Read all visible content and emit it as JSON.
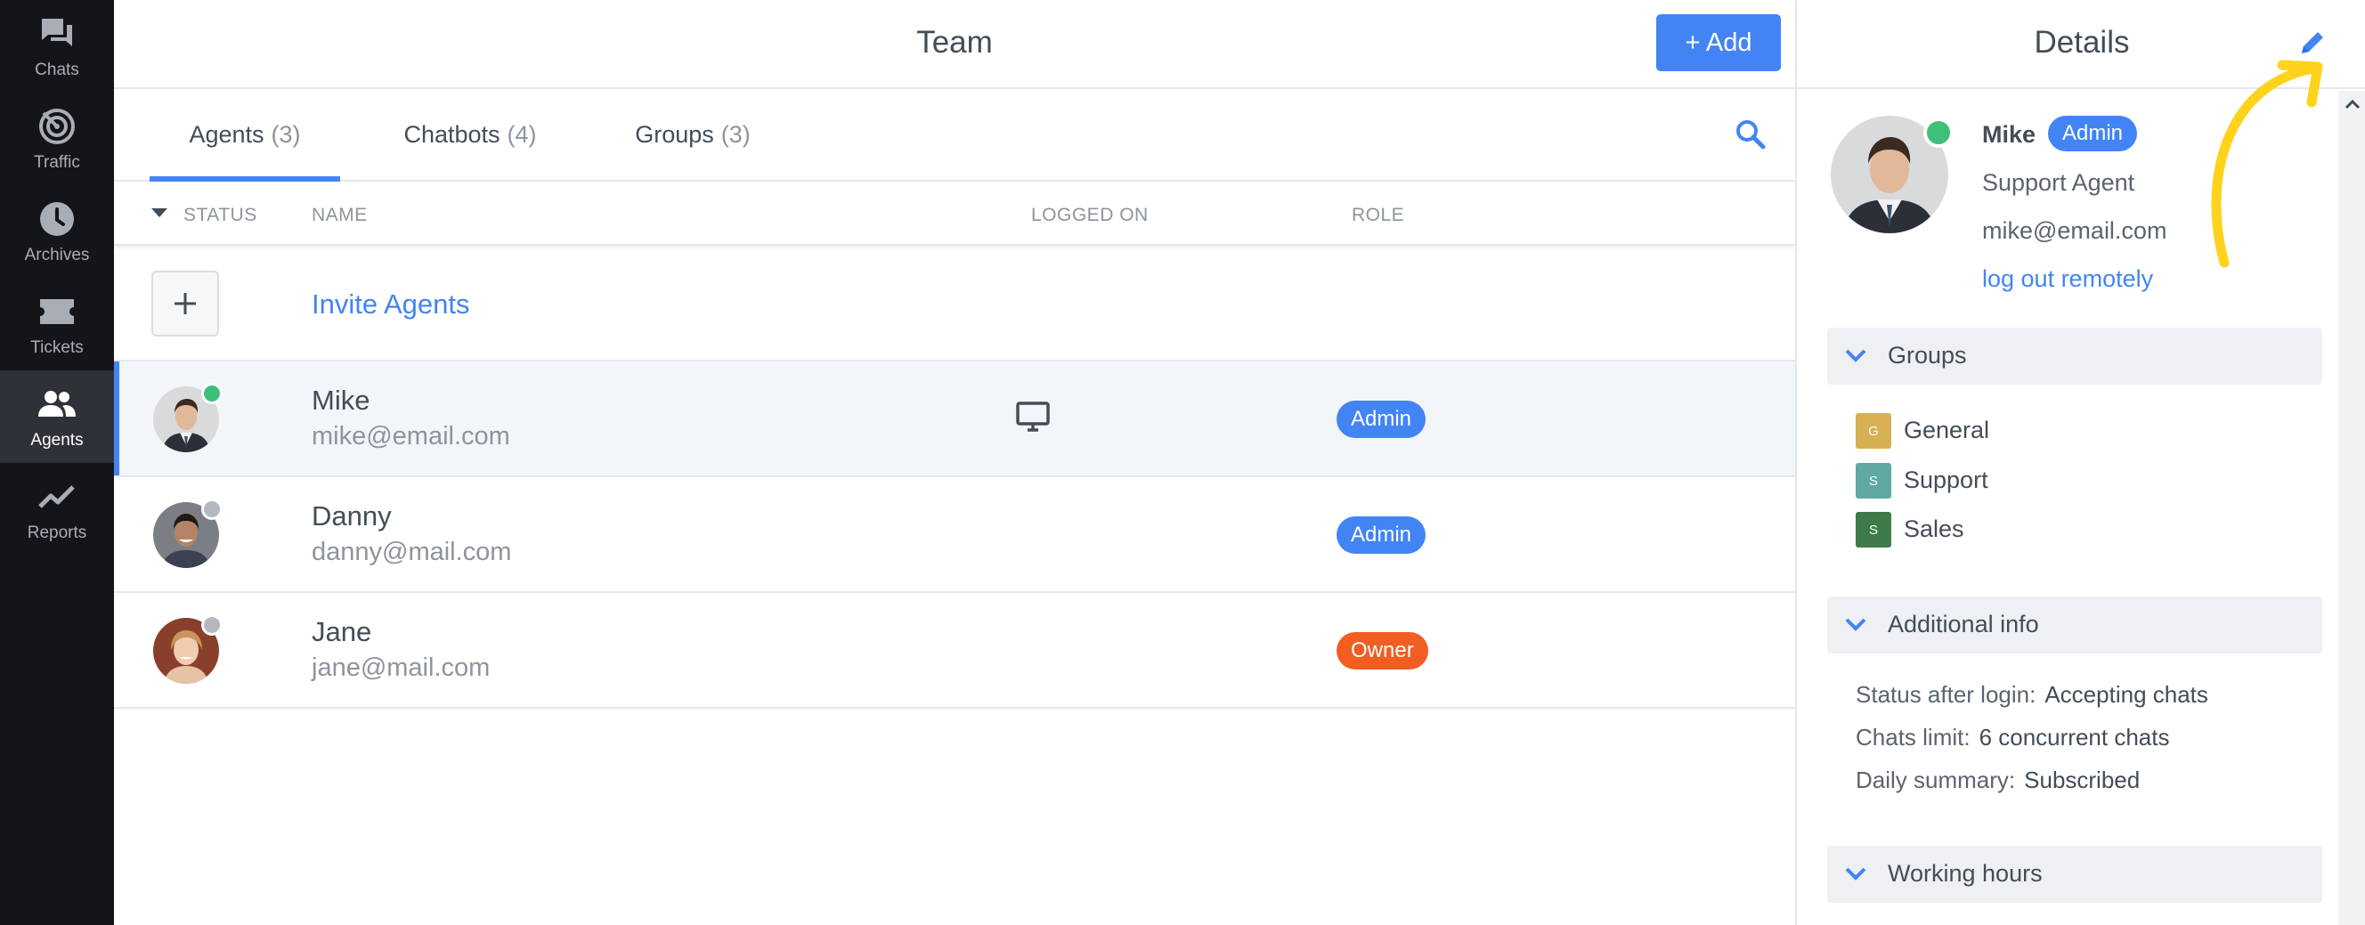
{
  "nav": {
    "items": [
      {
        "label": "Chats",
        "icon": "chats-icon"
      },
      {
        "label": "Traffic",
        "icon": "traffic-icon"
      },
      {
        "label": "Archives",
        "icon": "clock-icon"
      },
      {
        "label": "Tickets",
        "icon": "ticket-icon"
      },
      {
        "label": "Agents",
        "icon": "agents-icon",
        "active": true
      },
      {
        "label": "Reports",
        "icon": "reports-icon"
      }
    ]
  },
  "header": {
    "title": "Team",
    "add_label": "+ Add"
  },
  "tabs": [
    {
      "label": "Agents",
      "count": "(3)",
      "active": true
    },
    {
      "label": "Chatbots",
      "count": "(4)"
    },
    {
      "label": "Groups",
      "count": "(3)"
    }
  ],
  "table": {
    "columns": [
      "STATUS",
      "NAME",
      "LOGGED ON",
      "ROLE"
    ],
    "invite_label": "Invite Agents",
    "rows": [
      {
        "name": "Mike",
        "email": "mike@email.com",
        "role": "Admin",
        "status": "online",
        "logged_on": "desktop-icon"
      },
      {
        "name": "Danny",
        "email": "danny@mail.com",
        "role": "Admin",
        "status": "offline",
        "logged_on": ""
      },
      {
        "name": "Jane",
        "email": "jane@mail.com",
        "role": "Owner",
        "status": "offline",
        "logged_on": ""
      }
    ]
  },
  "details": {
    "title": "Details",
    "agent": {
      "name": "Mike",
      "badge": "Admin",
      "job_title": "Support Agent",
      "email": "mike@email.com",
      "logout_label": "log out remotely"
    },
    "groups_title": "Groups",
    "groups": [
      {
        "initial": "G",
        "name": "General",
        "color": "#d6b052"
      },
      {
        "initial": "S",
        "name": "Support",
        "color": "#5fa9a1"
      },
      {
        "initial": "S",
        "name": "Sales",
        "color": "#3f7a4a"
      }
    ],
    "additional_title": "Additional info",
    "info": [
      {
        "key": "Status after login:",
        "value": "Accepting chats"
      },
      {
        "key": "Chats limit:",
        "value": "6 concurrent chats"
      },
      {
        "key": "Daily summary:",
        "value": "Subscribed"
      }
    ],
    "working_hours_title": "Working hours"
  },
  "colors": {
    "accent": "#4384f5",
    "online": "#3ec07a",
    "offline": "#b4b9c0",
    "admin_badge": "#4384f5",
    "owner_badge": "#f25d22",
    "annotation": "#ffd21e"
  }
}
